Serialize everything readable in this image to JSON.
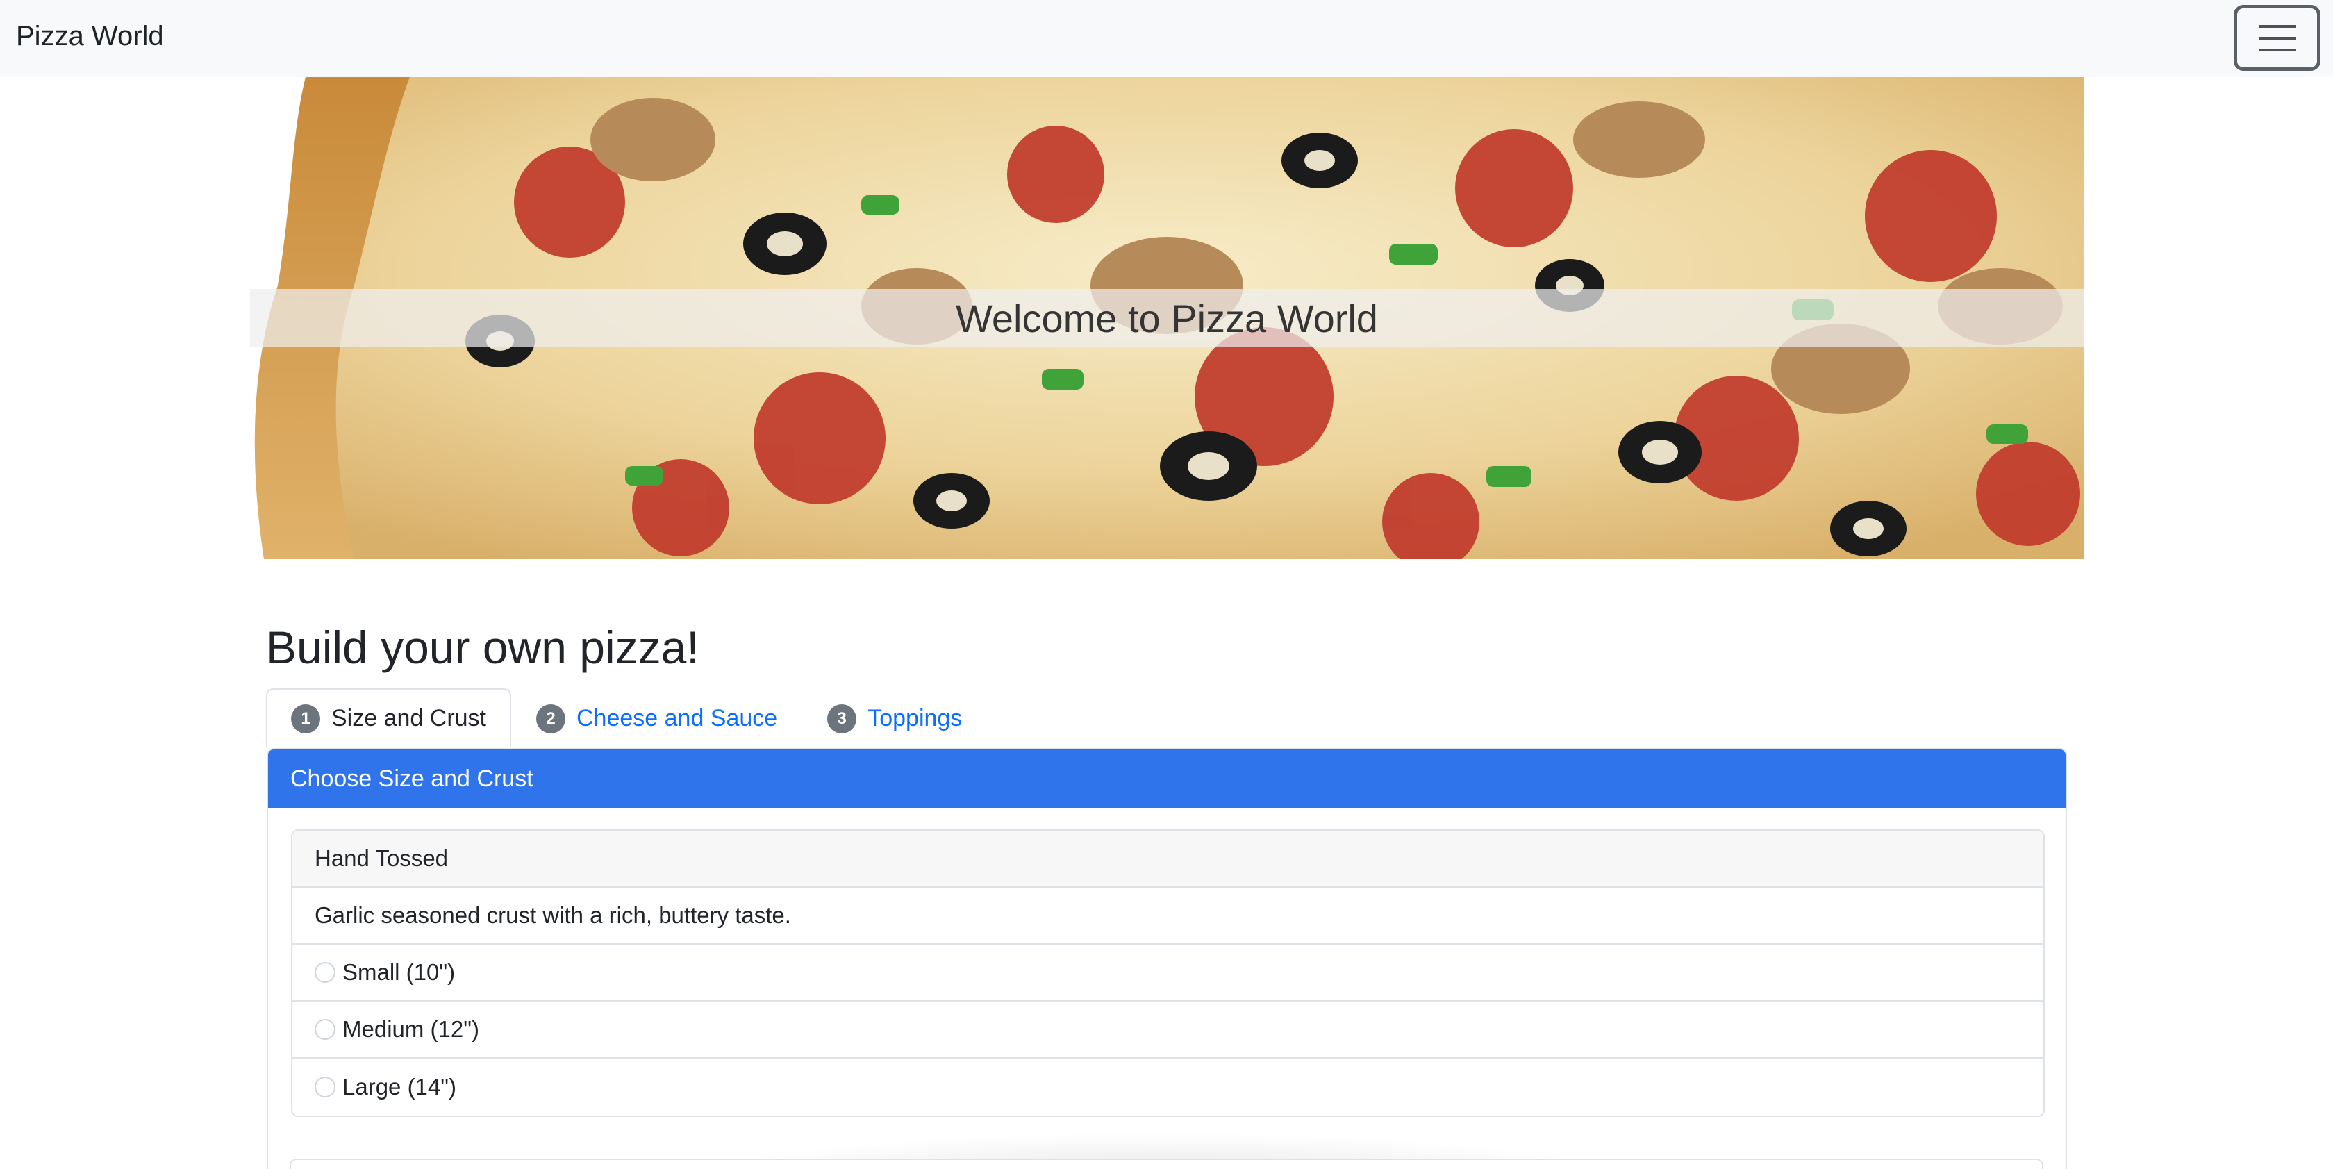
{
  "navbar": {
    "brand": "Pizza World",
    "toggler_icon": "hamburger-icon"
  },
  "hero": {
    "image_icon": "pizza-photo",
    "caption": "Welcome to Pizza World"
  },
  "main": {
    "heading": "Build your own pizza!",
    "tabs": [
      {
        "number": "1",
        "label": "Size and Crust",
        "active": true
      },
      {
        "number": "2",
        "label": "Cheese and Sauce",
        "active": false
      },
      {
        "number": "3",
        "label": "Toppings",
        "active": false
      }
    ],
    "card": {
      "header": "Choose Size and Crust",
      "crusts": [
        {
          "name": "Hand Tossed",
          "description": "Garlic seasoned crust with a rich, buttery taste.",
          "sizes": [
            "Small (10\")",
            "Medium (12\")",
            "Large (14\")"
          ]
        }
      ]
    }
  },
  "colors": {
    "navbar_bg": "#f8f9fa",
    "primary": "#2f74ea",
    "link": "#0d6efd",
    "badge": "#6c757d"
  }
}
